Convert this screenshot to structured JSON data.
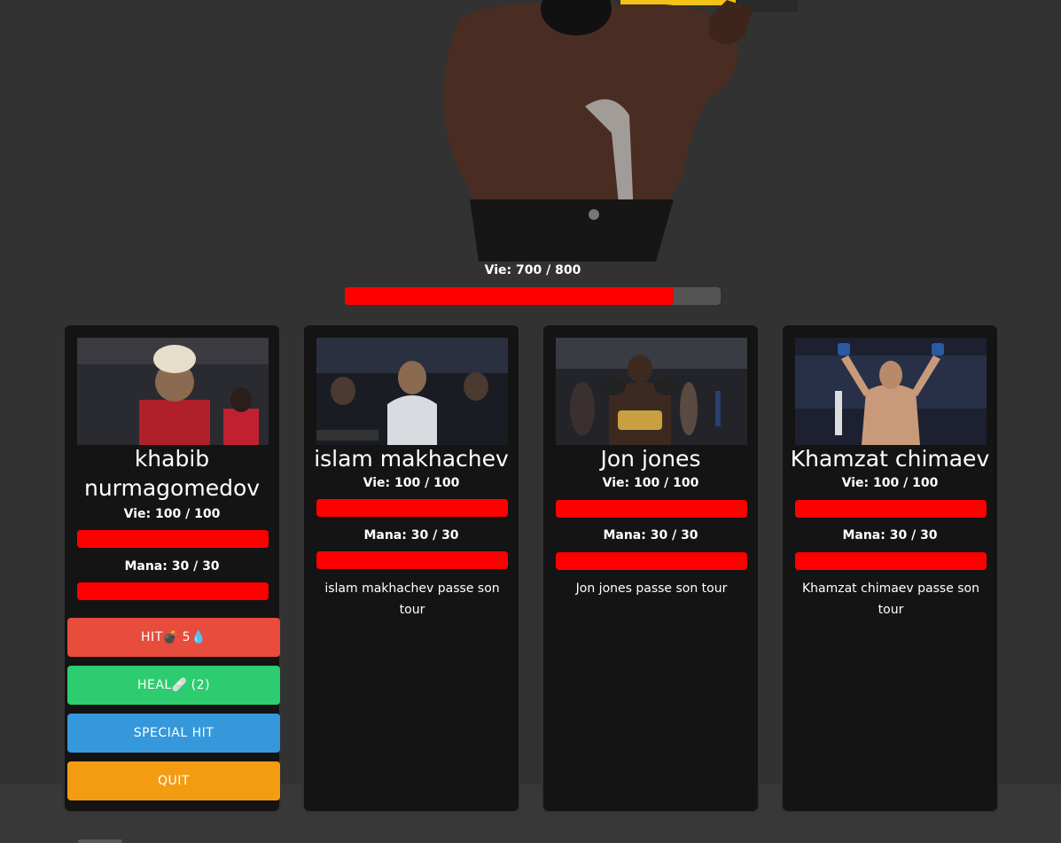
{
  "boss": {
    "life_label": "Vie: 700 / 800",
    "life_current": 700,
    "life_max": 800,
    "image_icon": "boss-fighter-image"
  },
  "heroes": [
    {
      "name": "khabib nurmagomedov",
      "life_label": "Vie: 100 / 100",
      "mana_label": "Mana: 30 / 30",
      "life_fraction": 1.0,
      "mana_fraction": 1.0,
      "actions": {
        "hit": {
          "label": "HIT",
          "icon_bomb": "💣",
          "cost": "5",
          "icon_mana": "💧",
          "color": "#e74c3c"
        },
        "heal": {
          "label": "HEAL",
          "icon": "🩹",
          "count": "(2)",
          "color": "#2ecc71"
        },
        "special": {
          "label": "SPECIAL HIT",
          "color": "#3498db"
        },
        "quit": {
          "label": "QUIT",
          "color": "#f39c12"
        }
      }
    },
    {
      "name": "islam makhachev",
      "life_label": "Vie: 100 / 100",
      "mana_label": "Mana: 30 / 30",
      "life_fraction": 1.0,
      "mana_fraction": 1.0,
      "turn_message": "islam makhachev passe son tour"
    },
    {
      "name": "Jon jones",
      "life_label": "Vie: 100 / 100",
      "mana_label": "Mana: 30 / 30",
      "life_fraction": 1.0,
      "mana_fraction": 1.0,
      "turn_message": "Jon jones passe son tour"
    },
    {
      "name": "Khamzat chimaev",
      "life_label": "Vie: 100 / 100",
      "mana_label": "Mana: 30 / 30",
      "life_fraction": 1.0,
      "mana_fraction": 1.0,
      "turn_message": "Khamzat chimaev passe son tour"
    }
  ],
  "colors": {
    "life": "#ff0000",
    "bar_bg": "#555555",
    "card_bg": "#141414",
    "page_bg": "#323232"
  }
}
